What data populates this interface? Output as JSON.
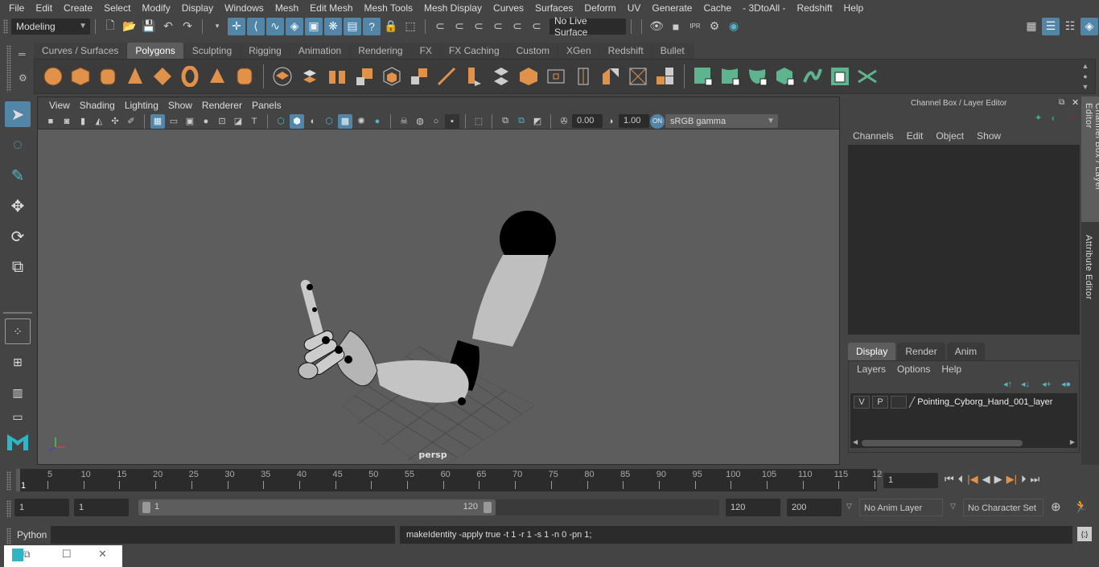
{
  "menubar": [
    "File",
    "Edit",
    "Create",
    "Select",
    "Modify",
    "Display",
    "Windows",
    "Mesh",
    "Edit Mesh",
    "Mesh Tools",
    "Mesh Display",
    "Curves",
    "Surfaces",
    "Deform",
    "UV",
    "Generate",
    "Cache",
    "- 3DtoAll -",
    "Redshift",
    "Help"
  ],
  "statusline": {
    "mode": "Modeling",
    "live_surface": "No Live Surface"
  },
  "shelf": {
    "tabs": [
      "Curves / Surfaces",
      "Polygons",
      "Sculpting",
      "Rigging",
      "Animation",
      "Rendering",
      "FX",
      "FX Caching",
      "Custom",
      "XGen",
      "Redshift",
      "Bullet"
    ],
    "active_tab": "Polygons"
  },
  "viewport": {
    "menu": [
      "View",
      "Shading",
      "Lighting",
      "Show",
      "Renderer",
      "Panels"
    ],
    "exposure": "0.00",
    "gamma": "1.00",
    "color_space": "sRGB gamma",
    "camera_label": "persp"
  },
  "channel_box": {
    "title": "Channel Box / Layer Editor",
    "menu": [
      "Channels",
      "Edit",
      "Object",
      "Show"
    ],
    "layer_tabs": [
      "Display",
      "Render",
      "Anim"
    ],
    "active_layer_tab": "Display",
    "layer_menu": [
      "Layers",
      "Options",
      "Help"
    ],
    "layers": [
      {
        "v": "V",
        "p": "P",
        "name": "Pointing_Cyborg_Hand_001_layer"
      }
    ]
  },
  "side_tabs": [
    "Channel Box / Layer Editor",
    "Attribute Editor"
  ],
  "timeline": {
    "ticks": [
      "5",
      "10",
      "15",
      "20",
      "25",
      "30",
      "35",
      "40",
      "45",
      "50",
      "55",
      "60",
      "65",
      "70",
      "75",
      "80",
      "85",
      "90",
      "95",
      "100",
      "105",
      "110",
      "115",
      "12"
    ],
    "current_frame_marker": "1",
    "current_frame": "1"
  },
  "range": {
    "start": "1",
    "playback_start": "1",
    "slider_start": "1",
    "slider_end": "120",
    "playback_end": "120",
    "end": "200",
    "anim_layer": "No Anim Layer",
    "character_set": "No Character Set"
  },
  "cmdline": {
    "language": "Python",
    "input": "",
    "result": "makeIdentity -apply true -t 1 -r 1 -s 1 -n 0 -pn 1;"
  }
}
